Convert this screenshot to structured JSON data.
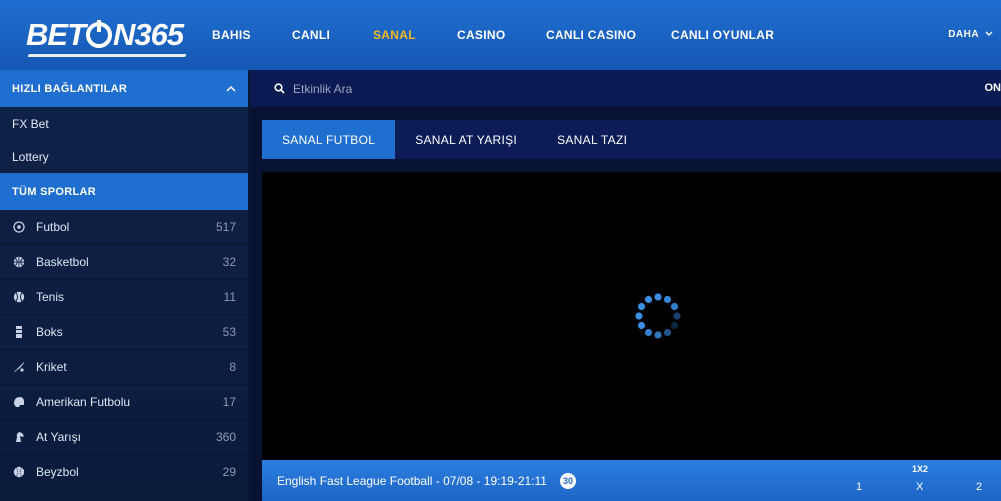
{
  "brand": {
    "logo_part1": "BET",
    "logo_part2": "N365"
  },
  "nav": {
    "items": [
      {
        "label": "BAHIS",
        "active": false
      },
      {
        "label": "CANLI",
        "active": false
      },
      {
        "label": "SANAL",
        "active": true
      },
      {
        "label": "CASINO",
        "active": false
      },
      {
        "label": "CANLI CASINO",
        "active": false
      },
      {
        "label": "CANLI OYUNLAR",
        "active": false
      }
    ],
    "more_label": "DAHA"
  },
  "sidebar": {
    "quick_links_title": "HIZLI BAĞLANTILAR",
    "quick_links": [
      "FX Bet",
      "Lottery"
    ],
    "all_sports_title": "TÜM SPORLAR",
    "sports": [
      {
        "name": "Futbol",
        "count": "517",
        "icon": "soccer-ball-icon"
      },
      {
        "name": "Basketbol",
        "count": "32",
        "icon": "basketball-icon"
      },
      {
        "name": "Tenis",
        "count": "11",
        "icon": "tennis-ball-icon"
      },
      {
        "name": "Boks",
        "count": "53",
        "icon": "boxing-icon"
      },
      {
        "name": "Kriket",
        "count": "8",
        "icon": "cricket-bat-icon"
      },
      {
        "name": "Amerikan Futbolu",
        "count": "17",
        "icon": "football-helmet-icon"
      },
      {
        "name": "At Yarışı",
        "count": "360",
        "icon": "horse-head-icon"
      },
      {
        "name": "Beyzbol",
        "count": "29",
        "icon": "baseball-icon"
      }
    ]
  },
  "search": {
    "placeholder": "Etkinlik Ara",
    "right_label": "ON"
  },
  "tabs": [
    {
      "label": "SANAL FUTBOL",
      "active": true
    },
    {
      "label": "SANAL AT YARIŞI",
      "active": false
    },
    {
      "label": "SANAL TAZI",
      "active": false
    }
  ],
  "match": {
    "title": "English Fast League Football - 07/08 - 19:19-21:11",
    "badge": "30",
    "market_label": "1X2",
    "outcomes": [
      "1",
      "X",
      "2"
    ]
  },
  "colors": {
    "brand_blue": "#1f6fd1",
    "active_nav": "#f5b820",
    "page_bg": "#0b1a3a"
  }
}
